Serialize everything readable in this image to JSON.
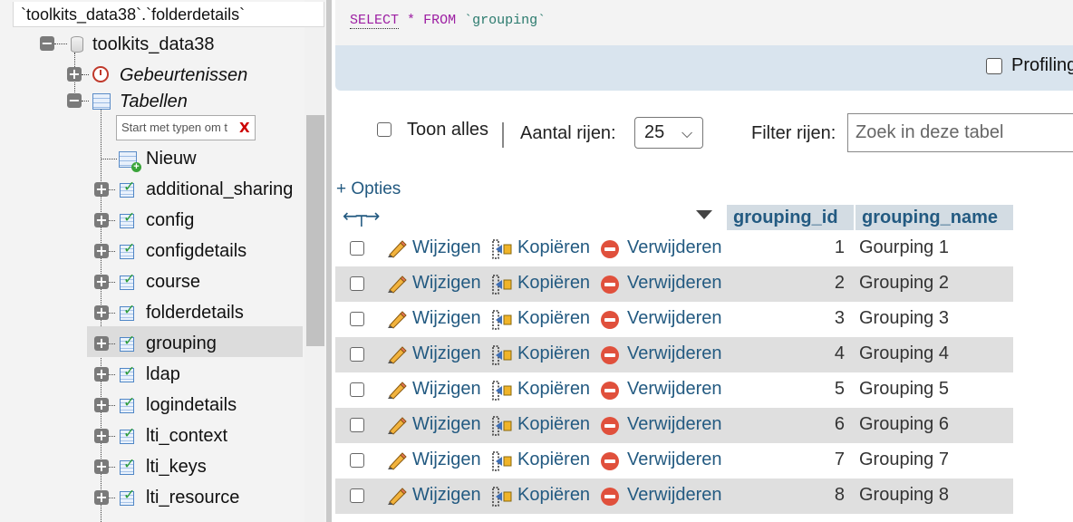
{
  "breadcrumb": "`toolkits_data38`.`folderdetails`",
  "navigation": {
    "database": "toolkits_data38",
    "events_label": "Gebeurtenissen",
    "tables_label": "Tabellen",
    "filter_placeholder": "Start met typen om t",
    "filter_clear": "X",
    "new_label": "Nieuw",
    "tables": [
      "additional_sharing",
      "config",
      "configdetails",
      "course",
      "folderdetails",
      "grouping",
      "ldap",
      "logindetails",
      "lti_context",
      "lti_keys",
      "lti_resource"
    ],
    "selected_table": "grouping",
    "expander_expanded": "−",
    "expander_collapsed": "+"
  },
  "sql": {
    "select": "SELECT",
    "star": "*",
    "from": "FROM",
    "table": "`grouping`"
  },
  "profiling_label": "Profiling",
  "controls": {
    "show_all_label": "Toon alles",
    "rows_label": "Aantal rijen:",
    "rows_value": "25",
    "filter_label": "Filter rijen:",
    "filter_placeholder": "Zoek in deze tabel",
    "options_label": "+ Opties"
  },
  "table": {
    "columns": [
      "grouping_id",
      "grouping_name"
    ],
    "actions": {
      "edit": "Wijzigen",
      "copy": "Kopiëren",
      "delete": "Verwijderen"
    },
    "rows": [
      {
        "id": "1",
        "name": "Gourping 1"
      },
      {
        "id": "2",
        "name": "Grouping 2"
      },
      {
        "id": "3",
        "name": "Grouping 3"
      },
      {
        "id": "4",
        "name": "Grouping 4"
      },
      {
        "id": "5",
        "name": "Grouping 5"
      },
      {
        "id": "6",
        "name": "Grouping 6"
      },
      {
        "id": "7",
        "name": "Grouping 7"
      },
      {
        "id": "8",
        "name": "Grouping 8"
      }
    ]
  },
  "colors": {
    "link": "#235a81",
    "header_bg": "#d3dce3",
    "row_alt": "#dfdfdf",
    "delete_icon": "#e0503c",
    "sql_keyword": "#9d1fa3",
    "sql_identifier": "#2a7a6d"
  }
}
